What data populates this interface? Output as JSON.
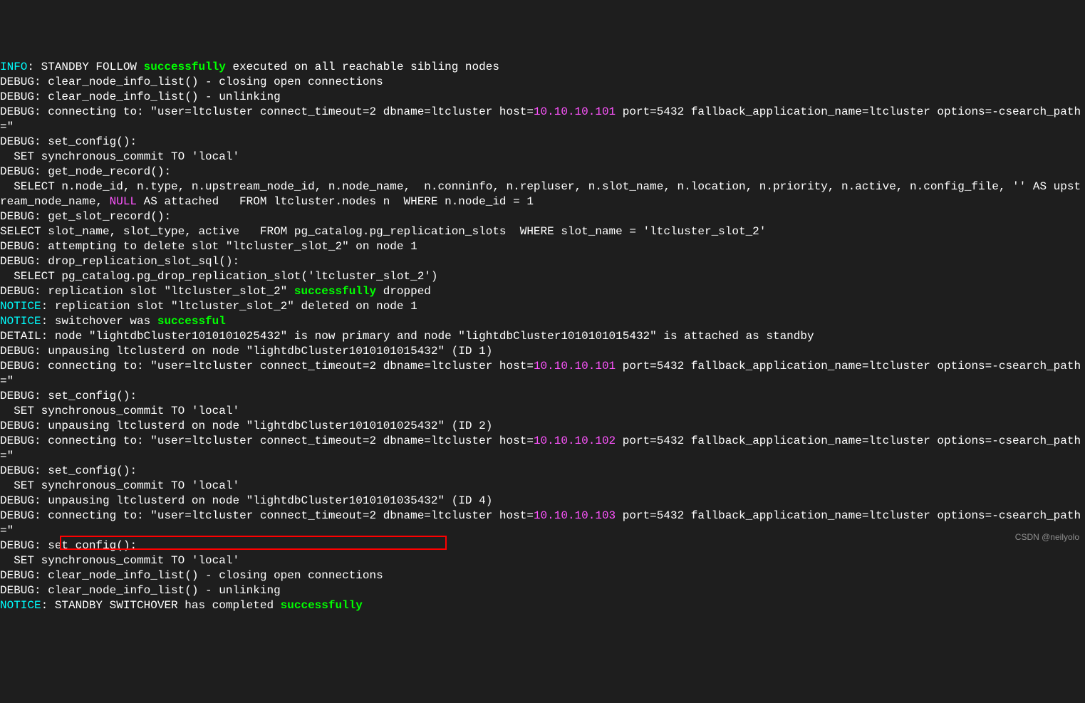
{
  "watermark": "CSDN @neilyolo",
  "lines": [
    {
      "parts": [
        {
          "cls": "INFO",
          "txt": "INFO"
        },
        {
          "cls": "white",
          "txt": ": STANDBY FOLLOW "
        },
        {
          "cls": "green",
          "txt": "successfully"
        },
        {
          "cls": "white",
          "txt": " executed on all reachable sibling nodes"
        }
      ]
    },
    {
      "parts": [
        {
          "cls": "DEBUG",
          "txt": "DEBUG"
        },
        {
          "cls": "white",
          "txt": ": clear_node_info_list() - closing open connections"
        }
      ]
    },
    {
      "parts": [
        {
          "cls": "DEBUG",
          "txt": "DEBUG"
        },
        {
          "cls": "white",
          "txt": ": clear_node_info_list() - unlinking"
        }
      ]
    },
    {
      "parts": [
        {
          "cls": "DEBUG",
          "txt": "DEBUG"
        },
        {
          "cls": "white",
          "txt": ": connecting to: \"user=ltcluster connect_timeout=2 dbname=ltcluster host="
        },
        {
          "cls": "magenta",
          "txt": "10.10.10.101"
        },
        {
          "cls": "white",
          "txt": " port=5432 fallback_application_name=ltcluster options=-csearch_path=\""
        }
      ]
    },
    {
      "parts": [
        {
          "cls": "DEBUG",
          "txt": "DEBUG"
        },
        {
          "cls": "white",
          "txt": ": set_config():"
        }
      ]
    },
    {
      "parts": [
        {
          "cls": "white",
          "txt": "  SET synchronous_commit TO 'local'"
        }
      ]
    },
    {
      "parts": [
        {
          "cls": "DEBUG",
          "txt": "DEBUG"
        },
        {
          "cls": "white",
          "txt": ": get_node_record():"
        }
      ]
    },
    {
      "parts": [
        {
          "cls": "white",
          "txt": "  SELECT n.node_id, n.type, n.upstream_node_id, n.node_name,  n.conninfo, n.repluser, n.slot_name, n.location, n.priority, n.active, n.config_file, '' AS upstream_node_name, "
        },
        {
          "cls": "magenta",
          "txt": "NULL"
        },
        {
          "cls": "white",
          "txt": " AS attached   FROM ltcluster.nodes n  WHERE n.node_id = 1"
        }
      ]
    },
    {
      "parts": [
        {
          "cls": "DEBUG",
          "txt": "DEBUG"
        },
        {
          "cls": "white",
          "txt": ": get_slot_record():"
        }
      ]
    },
    {
      "parts": [
        {
          "cls": "white",
          "txt": "SELECT slot_name, slot_type, active   FROM pg_catalog.pg_replication_slots  WHERE slot_name = 'ltcluster_slot_2'"
        }
      ]
    },
    {
      "parts": [
        {
          "cls": "DEBUG",
          "txt": "DEBUG"
        },
        {
          "cls": "white",
          "txt": ": attempting to delete slot \"ltcluster_slot_2\" on node 1"
        }
      ]
    },
    {
      "parts": [
        {
          "cls": "DEBUG",
          "txt": "DEBUG"
        },
        {
          "cls": "white",
          "txt": ": drop_replication_slot_sql():"
        }
      ]
    },
    {
      "parts": [
        {
          "cls": "white",
          "txt": "  SELECT pg_catalog.pg_drop_replication_slot('ltcluster_slot_2')"
        }
      ]
    },
    {
      "parts": [
        {
          "cls": "DEBUG",
          "txt": "DEBUG"
        },
        {
          "cls": "white",
          "txt": ": replication slot \"ltcluster_slot_2\" "
        },
        {
          "cls": "green",
          "txt": "successfully"
        },
        {
          "cls": "white",
          "txt": " dropped"
        }
      ]
    },
    {
      "parts": [
        {
          "cls": "NOTICE",
          "txt": "NOTICE"
        },
        {
          "cls": "white",
          "txt": ": replication slot \"ltcluster_slot_2\" deleted on node 1"
        }
      ]
    },
    {
      "parts": [
        {
          "cls": "NOTICE",
          "txt": "NOTICE"
        },
        {
          "cls": "white",
          "txt": ": switchover was "
        },
        {
          "cls": "green",
          "txt": "successful"
        }
      ]
    },
    {
      "parts": [
        {
          "cls": "DETAIL",
          "txt": "DETAIL"
        },
        {
          "cls": "white",
          "txt": ": node \"lightdbCluster1010101025432\" is now primary and node \"lightdbCluster1010101015432\" is attached as standby"
        }
      ]
    },
    {
      "parts": [
        {
          "cls": "DEBUG",
          "txt": "DEBUG"
        },
        {
          "cls": "white",
          "txt": ": unpausing ltclusterd on node \"lightdbCluster1010101015432\" (ID 1)"
        }
      ]
    },
    {
      "parts": [
        {
          "cls": "DEBUG",
          "txt": "DEBUG"
        },
        {
          "cls": "white",
          "txt": ": connecting to: \"user=ltcluster connect_timeout=2 dbname=ltcluster host="
        },
        {
          "cls": "magenta",
          "txt": "10.10.10.101"
        },
        {
          "cls": "white",
          "txt": " port=5432 fallback_application_name=ltcluster options=-csearch_path=\""
        }
      ]
    },
    {
      "parts": [
        {
          "cls": "DEBUG",
          "txt": "DEBUG"
        },
        {
          "cls": "white",
          "txt": ": set_config():"
        }
      ]
    },
    {
      "parts": [
        {
          "cls": "white",
          "txt": "  SET synchronous_commit TO 'local'"
        }
      ]
    },
    {
      "parts": [
        {
          "cls": "DEBUG",
          "txt": "DEBUG"
        },
        {
          "cls": "white",
          "txt": ": unpausing ltclusterd on node \"lightdbCluster1010101025432\" (ID 2)"
        }
      ]
    },
    {
      "parts": [
        {
          "cls": "DEBUG",
          "txt": "DEBUG"
        },
        {
          "cls": "white",
          "txt": ": connecting to: \"user=ltcluster connect_timeout=2 dbname=ltcluster host="
        },
        {
          "cls": "magenta",
          "txt": "10.10.10.102"
        },
        {
          "cls": "white",
          "txt": " port=5432 fallback_application_name=ltcluster options=-csearch_path=\""
        }
      ]
    },
    {
      "parts": [
        {
          "cls": "DEBUG",
          "txt": "DEBUG"
        },
        {
          "cls": "white",
          "txt": ": set_config():"
        }
      ]
    },
    {
      "parts": [
        {
          "cls": "white",
          "txt": "  SET synchronous_commit TO 'local'"
        }
      ]
    },
    {
      "parts": [
        {
          "cls": "DEBUG",
          "txt": "DEBUG"
        },
        {
          "cls": "white",
          "txt": ": unpausing ltclusterd on node \"lightdbCluster1010101035432\" (ID 4)"
        }
      ]
    },
    {
      "parts": [
        {
          "cls": "DEBUG",
          "txt": "DEBUG"
        },
        {
          "cls": "white",
          "txt": ": connecting to: \"user=ltcluster connect_timeout=2 dbname=ltcluster host="
        },
        {
          "cls": "magenta",
          "txt": "10.10.10.103"
        },
        {
          "cls": "white",
          "txt": " port=5432 fallback_application_name=ltcluster options=-csearch_path=\""
        }
      ]
    },
    {
      "parts": [
        {
          "cls": "DEBUG",
          "txt": "DEBUG"
        },
        {
          "cls": "white",
          "txt": ": set_config():"
        }
      ]
    },
    {
      "parts": [
        {
          "cls": "white",
          "txt": "  SET synchronous_commit TO 'local'"
        }
      ]
    },
    {
      "parts": [
        {
          "cls": "DEBUG",
          "txt": "DEBUG"
        },
        {
          "cls": "white",
          "txt": ": clear_node_info_list() - closing open connections"
        }
      ]
    },
    {
      "parts": [
        {
          "cls": "DEBUG",
          "txt": "DEBUG"
        },
        {
          "cls": "white",
          "txt": ": clear_node_info_list() - unlinking"
        }
      ]
    },
    {
      "parts": [
        {
          "cls": "NOTICE",
          "txt": "NOTICE"
        },
        {
          "cls": "white",
          "txt": ": STANDBY SWITCHOVER has completed "
        },
        {
          "cls": "green",
          "txt": "successfully"
        }
      ]
    }
  ]
}
